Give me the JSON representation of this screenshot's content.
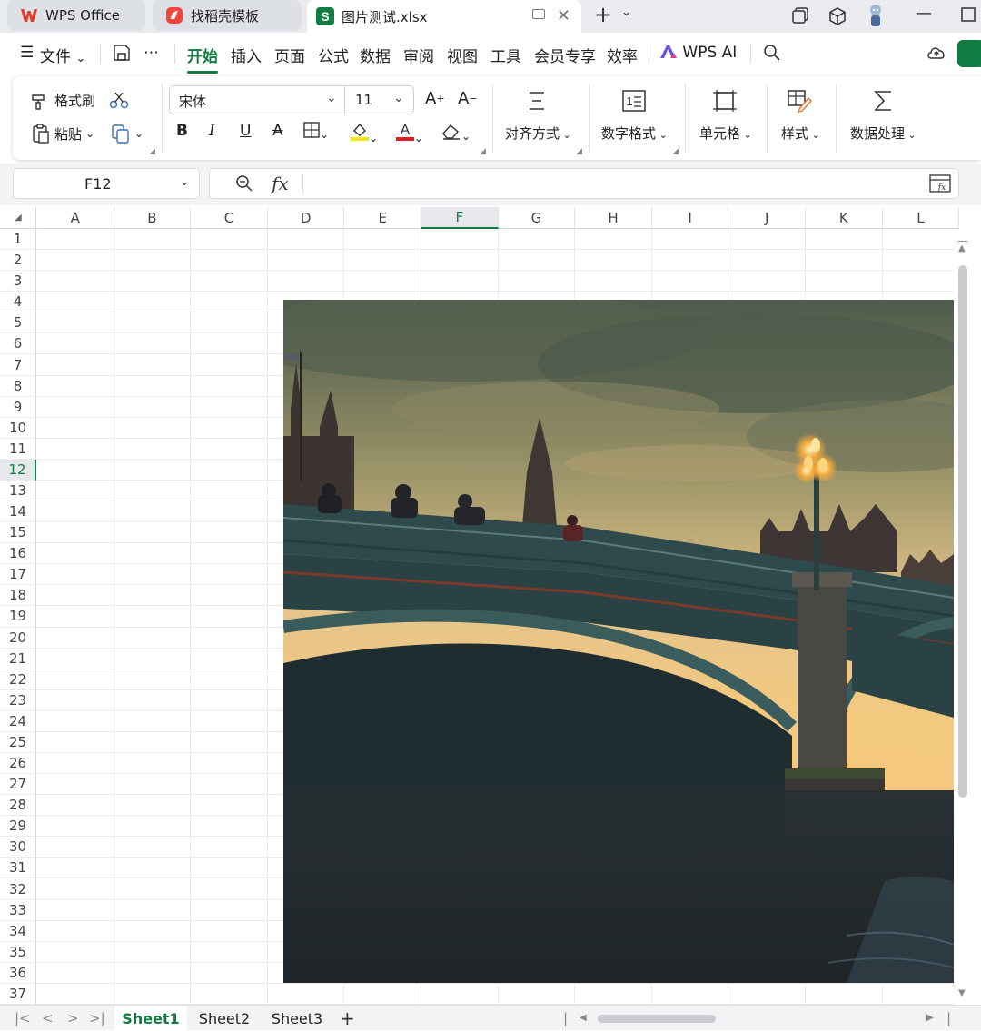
{
  "tabs": [
    {
      "label": "WPS Office"
    },
    {
      "label": "找稻壳模板"
    },
    {
      "label": "图片测试.xlsx"
    }
  ],
  "menu": {
    "file": "文件",
    "items": [
      "开始",
      "插入",
      "页面",
      "公式",
      "数据",
      "审阅",
      "视图",
      "工具",
      "会员专享",
      "效率"
    ],
    "ai": "WPS AI"
  },
  "ribbon": {
    "format_painter": "格式刷",
    "paste": "粘贴",
    "font_name": "宋体",
    "font_size": "11",
    "bold": "B",
    "italic": "I",
    "underline": "U",
    "strike": "A",
    "align": "对齐方式",
    "number_format": "数字格式",
    "cell": "单元格",
    "style": "样式",
    "data_proc": "数据处理"
  },
  "formula_bar": {
    "name_box": "F12",
    "fx": "fx"
  },
  "columns": [
    "A",
    "B",
    "C",
    "D",
    "E",
    "F",
    "G",
    "H",
    "I",
    "J",
    "K",
    "L"
  ],
  "rows": [
    "1",
    "2",
    "3",
    "4",
    "5",
    "6",
    "7",
    "8",
    "9",
    "10",
    "11",
    "12",
    "13",
    "14",
    "15",
    "16",
    "17",
    "18",
    "19",
    "20",
    "21",
    "22",
    "23",
    "24",
    "25",
    "26",
    "27",
    "28",
    "29",
    "30",
    "31",
    "32",
    "33",
    "34",
    "35",
    "36",
    "37"
  ],
  "selected_column": "F",
  "selected_row": "12",
  "sheets": [
    "Sheet1",
    "Sheet2",
    "Sheet3"
  ],
  "active_sheet": "Sheet1",
  "colors": {
    "accent": "#107c41",
    "wps_red": "#e23b2d"
  }
}
